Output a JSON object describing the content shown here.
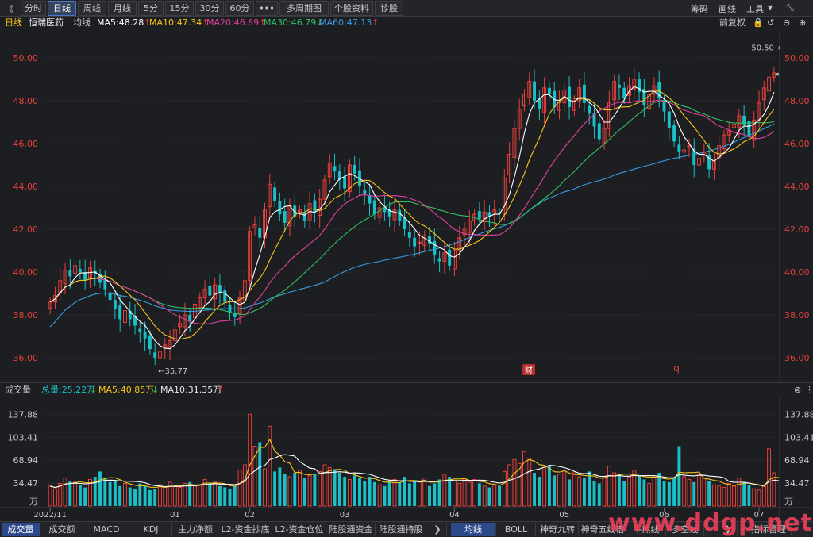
{
  "toolbar": {
    "back": "《",
    "periods": [
      "分时",
      "日线",
      "周线",
      "月线",
      "5分",
      "15分",
      "30分",
      "60分",
      "•••",
      "多周期图",
      "个股资料",
      "诊股"
    ],
    "active_period": "日线",
    "right": [
      "筹码",
      "画线",
      "工具"
    ]
  },
  "infobar": {
    "period": "日线",
    "stock": "恒瑞医药",
    "avg_label": "均线",
    "ma": [
      {
        "text": "MA5:48.28",
        "arrow": "↑",
        "color": "#ffffff",
        "arrow_color": "#e8403a"
      },
      {
        "text": "MA10:47.34",
        "arrow": "↑",
        "color": "#f5c518",
        "arrow_color": "#e8403a"
      },
      {
        "text": "MA20:46.69",
        "arrow": "↑",
        "color": "#e040a0",
        "arrow_color": "#e8403a"
      },
      {
        "text": "MA30:46.79",
        "arrow": "↓",
        "color": "#30c060",
        "arrow_color": "#30c060"
      },
      {
        "text": "MA60:47.13",
        "arrow": "↑",
        "color": "#3a9ae0",
        "arrow_color": "#e8403a"
      }
    ],
    "adjust": "前复权"
  },
  "price_axis": {
    "left_labels": [
      "50.00",
      "48.00",
      "46.00",
      "44.00",
      "42.00",
      "40.00",
      "38.00",
      "36.00"
    ],
    "right_labels": [
      "50.00",
      "48.00",
      "46.00",
      "44.00",
      "42.00",
      "40.00",
      "38.00",
      "36.00"
    ],
    "ylim": [
      35.0,
      51.0
    ],
    "high_mark": "50.50",
    "low_mark": "35.77",
    "badges": [
      "财",
      "q"
    ]
  },
  "volume": {
    "title": "成交量",
    "total": "总量:25.22万",
    "total_arrow": "↓",
    "ma5": "MA5:40.85万",
    "ma5_arrow": "↓",
    "ma10": "MA10:31.35万",
    "ma10_arrow": "↑",
    "axis_labels": [
      "137.88",
      "103.41",
      "68.94",
      "34.47",
      "万"
    ],
    "ylim": [
      0,
      155
    ]
  },
  "x_axis": {
    "labels": [
      "2022/11",
      "01",
      "02",
      "03",
      "04",
      "05",
      "06",
      "07"
    ]
  },
  "bottom_tabs": [
    "成交量",
    "成交额",
    "MACD",
    "KDJ",
    "主力净额",
    "L2-资金抄底",
    "L2-资金仓位",
    "陆股通资金",
    "陆股通持股",
    "均线",
    "BOLL",
    "神奇九转",
    "神奇五线谱",
    "牛熊线",
    "多空线",
    "指标管理"
  ],
  "watermark": "www.ddgp.net",
  "colors": {
    "up": "#e8403a",
    "down": "#19c0c8",
    "ma5": "#ffffff",
    "ma10": "#f5c518",
    "ma20": "#e040a0",
    "ma30": "#30c060",
    "ma60": "#3a9ae0"
  },
  "chart_data": {
    "type": "candlestick",
    "closes": [
      38.6,
      38.9,
      39.6,
      40.1,
      39.8,
      40.3,
      40.0,
      39.6,
      40.2,
      39.9,
      39.5,
      39.2,
      38.7,
      38.3,
      37.8,
      38.2,
      37.8,
      37.5,
      37.2,
      36.9,
      36.4,
      36.0,
      36.3,
      36.6,
      36.8,
      37.3,
      37.6,
      38.0,
      37.7,
      38.5,
      38.8,
      39.2,
      38.9,
      39.4,
      39.0,
      38.6,
      38.1,
      37.9,
      38.8,
      39.6,
      41.9,
      42.2,
      41.6,
      42.9,
      44.1,
      43.3,
      42.7,
      42.3,
      43.1,
      42.6,
      42.9,
      42.4,
      43.2,
      42.8,
      43.4,
      44.3,
      45.1,
      44.7,
      44.3,
      43.9,
      45.0,
      44.6,
      44.0,
      43.6,
      43.2,
      42.7,
      43.0,
      42.8,
      42.6,
      42.9,
      42.4,
      42.0,
      41.6,
      41.2,
      41.4,
      41.7,
      41.3,
      40.8,
      40.5,
      40.9,
      40.3,
      41.0,
      41.6,
      42.0,
      42.4,
      42.7,
      42.5,
      42.8,
      42.6,
      42.9,
      42.7,
      44.4,
      45.5,
      46.7,
      47.6,
      48.3,
      48.9,
      48.0,
      47.6,
      48.6,
      48.3,
      47.7,
      47.9,
      48.5,
      47.7,
      48.0,
      48.6,
      47.9,
      47.4,
      46.8,
      46.2,
      46.7,
      47.9,
      48.9,
      48.6,
      48.1,
      48.7,
      49.0,
      48.4,
      47.8,
      48.3,
      48.7,
      48.1,
      47.5,
      46.7,
      46.1,
      45.6,
      45.7,
      45.9,
      45.0,
      45.3,
      45.6,
      44.8,
      45.2,
      45.9,
      46.4,
      46.6,
      46.9,
      47.3,
      46.9,
      46.3,
      47.1,
      47.9,
      48.6,
      49.1,
      49.3
    ],
    "volumes": [
      30,
      26,
      34,
      42,
      38,
      36,
      32,
      28,
      40,
      44,
      52,
      42,
      36,
      38,
      30,
      34,
      28,
      26,
      34,
      30,
      24,
      26,
      32,
      28,
      36,
      30,
      28,
      34,
      36,
      30,
      32,
      40,
      34,
      36,
      30,
      28,
      26,
      30,
      54,
      62,
      138,
      90,
      96,
      56,
      120,
      52,
      58,
      48,
      44,
      50,
      54,
      42,
      46,
      48,
      52,
      62,
      58,
      54,
      50,
      44,
      40,
      46,
      42,
      38,
      44,
      36,
      32,
      30,
      38,
      40,
      36,
      44,
      34,
      38,
      36,
      42,
      30,
      34,
      40,
      48,
      44,
      38,
      34,
      42,
      36,
      40,
      34,
      30,
      28,
      32,
      30,
      52,
      62,
      70,
      64,
      82,
      72,
      50,
      44,
      58,
      60,
      46,
      48,
      54,
      40,
      50,
      44,
      42,
      52,
      38,
      34,
      44,
      60,
      50,
      48,
      38,
      44,
      54,
      46,
      40,
      34,
      44,
      50,
      38,
      36,
      42,
      90,
      44,
      40,
      36,
      46,
      42,
      38,
      32,
      30,
      28,
      34,
      30,
      42,
      36,
      32,
      26,
      24,
      30,
      86,
      50,
      25
    ]
  }
}
